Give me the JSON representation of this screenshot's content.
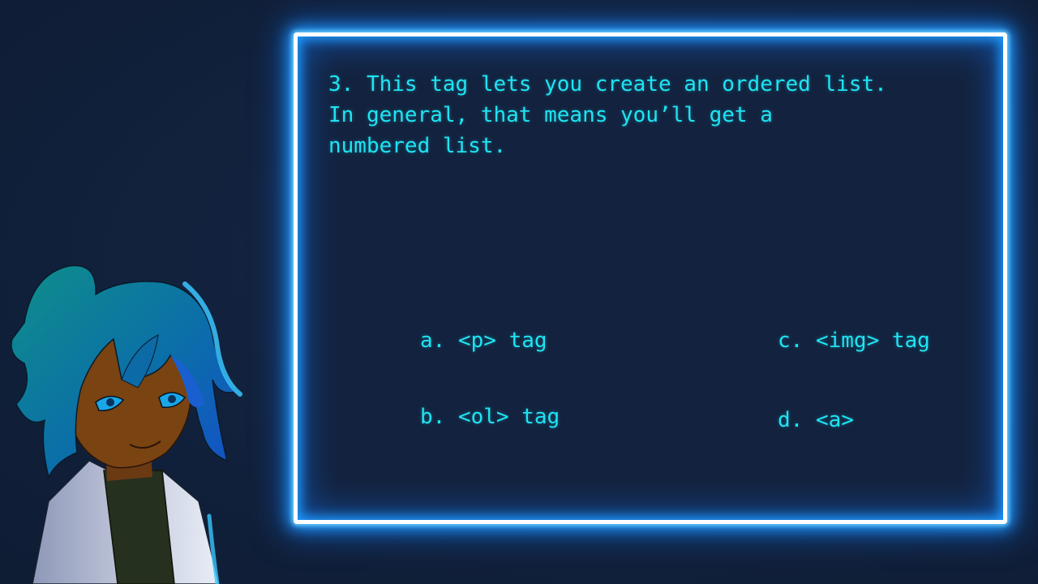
{
  "quiz": {
    "question": "3. This tag lets you create an ordered list.\nIn general, that means you’ll get a\nnumbered list.",
    "options": {
      "a": "a. <p> tag",
      "b": "b. <ol> tag",
      "c": "c. <img> tag",
      "d": "d. <a>"
    }
  },
  "colors": {
    "background": "#13233f",
    "text": "#1fe3f2",
    "frame_glow": "#1f9bff",
    "frame_border": "#ffffff"
  },
  "character": {
    "icon": "character-portrait"
  }
}
